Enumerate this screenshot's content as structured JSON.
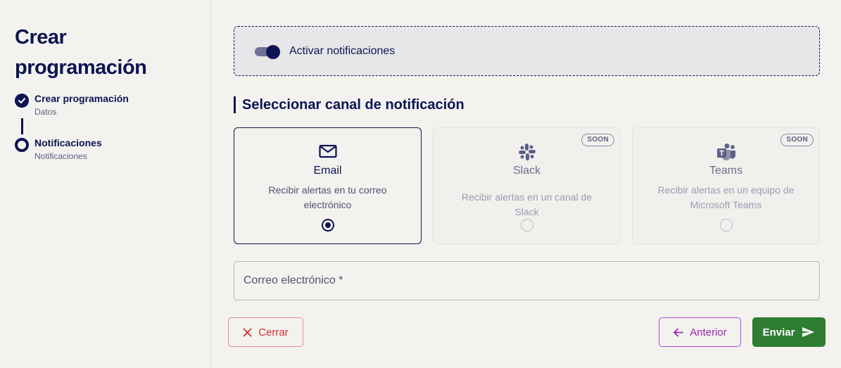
{
  "sidebar": {
    "title": "Crear programación",
    "steps": [
      {
        "title": "Crear programación",
        "subtitle": "Datos",
        "status": "completed"
      },
      {
        "title": "Notificaciones",
        "subtitle": "Notificaciones",
        "status": "current"
      }
    ]
  },
  "notifications_toggle": {
    "label": "Activar notificaciones",
    "enabled": true
  },
  "channel_section": {
    "title": "Seleccionar canal de notificación",
    "channels": [
      {
        "icon": "mail-icon",
        "name": "Email",
        "description": "Recibir alertas en tu correo electrónico",
        "selected": true,
        "badge": ""
      },
      {
        "icon": "slack-icon",
        "name": "Slack",
        "description": "Recibir alertas en un canal de Slack",
        "selected": false,
        "badge": "SOON"
      },
      {
        "icon": "teams-icon",
        "name": "Teams",
        "description": "Recibir alertas en un equipo de Microsoft Teams",
        "selected": false,
        "badge": "SOON"
      }
    ]
  },
  "email_field": {
    "placeholder": "Correo electrónico *",
    "value": ""
  },
  "actions": {
    "close_label": "Cerrar",
    "previous_label": "Anterior",
    "send_label": "Enviar"
  },
  "colors": {
    "primary": "#0d1452",
    "error": "#d32f2f",
    "secondary": "#9c27b0",
    "success": "#2e7d32",
    "background": "#f3f2ef"
  }
}
